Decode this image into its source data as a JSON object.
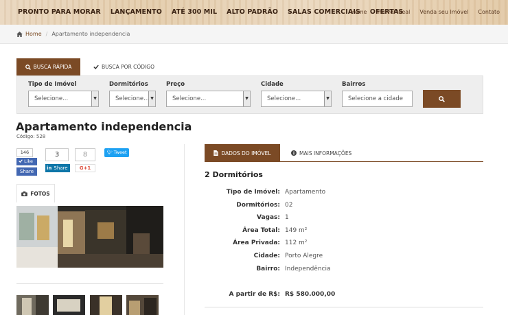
{
  "nav": {
    "main": [
      "PRONTO PARA MORAR",
      "LANÇAMENTO",
      "ATÉ 300 MIL",
      "ALTO PADRÃO",
      "SALAS COMERCIAIS",
      "OFERTAS"
    ],
    "secondary": [
      "Home",
      "Imóvel Ideal",
      "Venda seu Imóvel",
      "Contato"
    ]
  },
  "breadcrumb": {
    "home": "Home",
    "current": "Apartamento independencia"
  },
  "search": {
    "tab_quick": "BUSCA RÁPIDA",
    "tab_code": "BUSCA POR CÓDIGO",
    "fields": {
      "tipo": {
        "label": "Tipo de Imóvel",
        "value": "Selecione..."
      },
      "dormitorios": {
        "label": "Dormitórios",
        "value": "Selecione..."
      },
      "preco": {
        "label": "Preço",
        "value": "Selecione..."
      },
      "cidade": {
        "label": "Cidade",
        "value": "Selecione..."
      },
      "bairros": {
        "label": "Bairros",
        "placeholder": "Selecione a cidade"
      }
    }
  },
  "property": {
    "title": "Apartamento independencia",
    "code": "Código: 528"
  },
  "social": {
    "fb_count": "146",
    "fb_like": "Like",
    "fb_share": "Share",
    "li_count": "3",
    "li_share": "Share",
    "g_count": "8",
    "g_plus": "G+1",
    "tweet": "Tweet"
  },
  "gallery": {
    "tab_label": "FOTOS"
  },
  "details": {
    "tab_data": "DADOS DO IMÓVEL",
    "tab_more": "MAIS INFORMAÇÕES",
    "heading": "2 Dormitórios",
    "specs": [
      {
        "k": "Tipo de Imóvel:",
        "v": "Apartamento"
      },
      {
        "k": "Dormitórios:",
        "v": "02"
      },
      {
        "k": "Vagas:",
        "v": "1"
      },
      {
        "k": "Área Total:",
        "v": "149 m²"
      },
      {
        "k": "Área Privada:",
        "v": "112 m²"
      },
      {
        "k": "Cidade:",
        "v": "Porto Alegre"
      },
      {
        "k": "Bairro:",
        "v": "Independência"
      }
    ],
    "price_label": "A partir de R$:",
    "price_value": "R$ 580.000,00"
  },
  "colors": {
    "brand": "#7b4a25",
    "facebook": "#4267b2",
    "linkedin": "#0e76a8",
    "twitter": "#1da1f2"
  }
}
